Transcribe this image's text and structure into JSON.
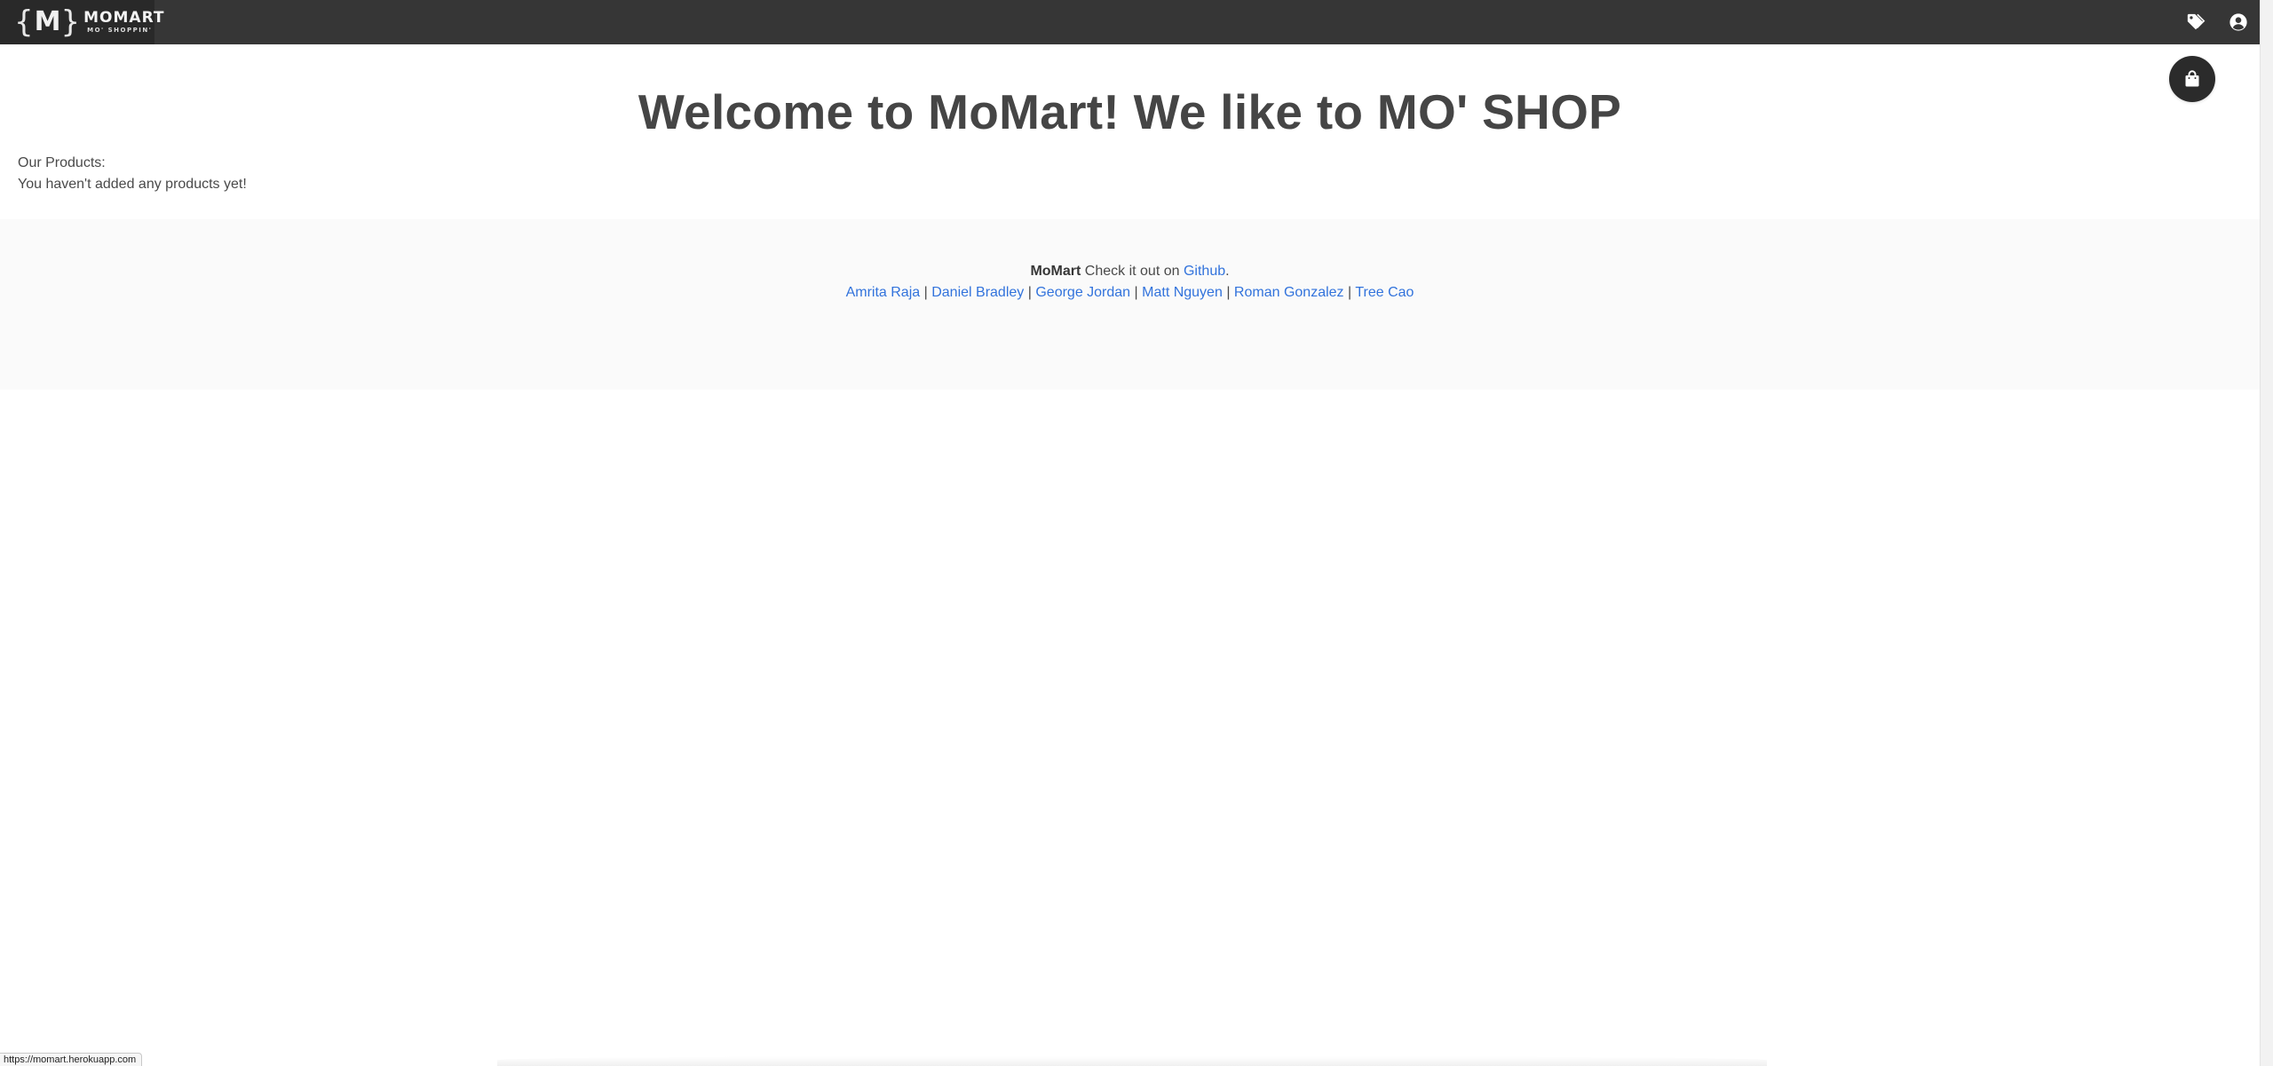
{
  "navbar": {
    "logo": {
      "mark": "M",
      "title": "MOMART",
      "subtitle": "MO' SHOPPIN'"
    },
    "icons": [
      "tag-icon",
      "user-circle-icon"
    ]
  },
  "cart": {
    "icon": "shopping-bag-icon"
  },
  "main": {
    "title": "Welcome to MoMart! We like to MO' SHOP",
    "products_label": "Our Products:",
    "empty_message": "You haven't added any products yet!"
  },
  "footer": {
    "brand": "MoMart",
    "text": "Check it out on",
    "github_link": "Github",
    "period": ".",
    "authors": [
      "Amrita Raja",
      "Daniel Bradley",
      "George Jordan",
      "Matt Nguyen",
      "Roman Gonzalez",
      "Tree Cao"
    ],
    "separator": "|"
  },
  "status_bar": {
    "url": "https://momart.herokuapp.com"
  },
  "colors": {
    "navbar": "#363636",
    "brand_bg": "#292929",
    "link": "#3273dc",
    "title": "#454545",
    "footer_bg": "#fafafa"
  }
}
